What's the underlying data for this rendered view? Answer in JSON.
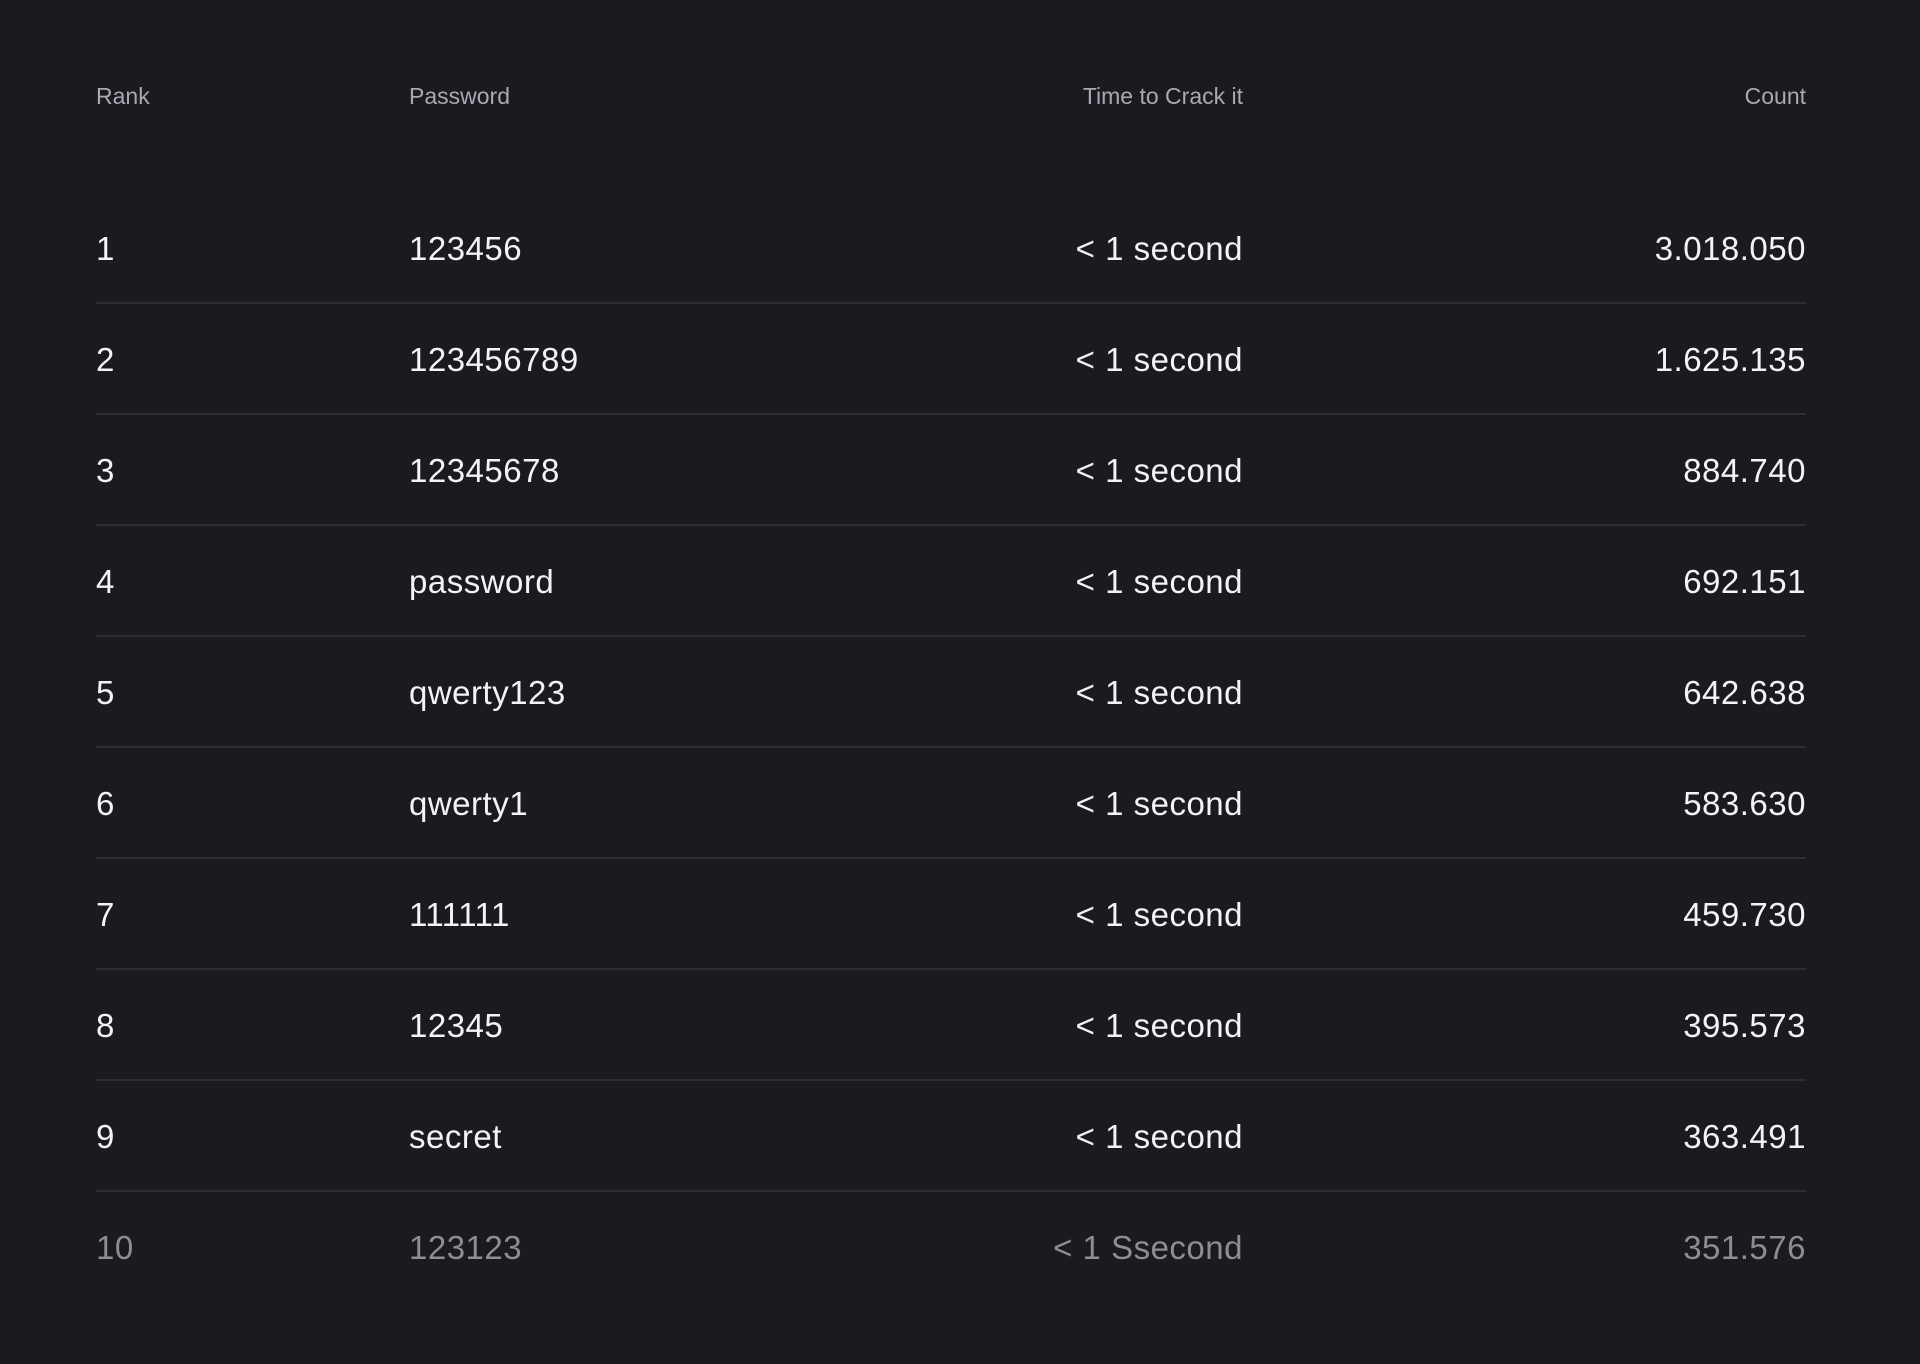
{
  "table": {
    "headers": {
      "rank": "Rank",
      "password": "Password",
      "time": "Time to Crack it",
      "count": "Count"
    },
    "rows": [
      {
        "rank": "1",
        "password": "123456",
        "time": "< 1 second",
        "count": "3.018.050"
      },
      {
        "rank": "2",
        "password": "123456789",
        "time": "< 1 second",
        "count": "1.625.135"
      },
      {
        "rank": "3",
        "password": "12345678",
        "time": "< 1 second",
        "count": "884.740"
      },
      {
        "rank": "4",
        "password": "password",
        "time": "< 1 second",
        "count": "692.151"
      },
      {
        "rank": "5",
        "password": "qwerty123",
        "time": "< 1 second",
        "count": "642.638"
      },
      {
        "rank": "6",
        "password": "qwerty1",
        "time": "< 1 second",
        "count": "583.630"
      },
      {
        "rank": "7",
        "password": "111111",
        "time": "< 1 second",
        "count": "459.730"
      },
      {
        "rank": "8",
        "password": "12345",
        "time": "< 1 second",
        "count": "395.573"
      },
      {
        "rank": "9",
        "password": "secret",
        "time": "< 1 second",
        "count": "363.491"
      },
      {
        "rank": "10",
        "password": "123123",
        "time": "< 1 Ssecond",
        "count": "351.576"
      }
    ]
  },
  "colors": {
    "background": "#1b1a20",
    "divider": "#2e2d34",
    "header_text": "#a9a9b1",
    "body_text": "#f4f4f6",
    "faded_text": "#8e8d94"
  }
}
